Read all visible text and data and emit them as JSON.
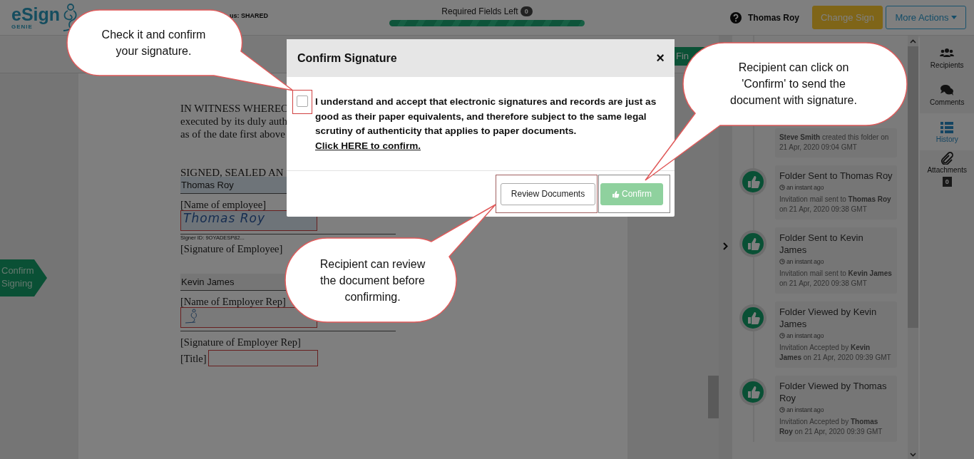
{
  "header": {
    "logo": {
      "name": "eSign",
      "tagline": "GENIE"
    },
    "status": "us: SHARED",
    "required_fields": {
      "label": "Required Fields Left",
      "count": "0",
      "level": 1
    },
    "user": "Thomas Roy",
    "buttons": [
      {
        "label": "Change Sign",
        "kind": "primary"
      },
      {
        "label": "More Actions",
        "kind": "dropdown"
      }
    ]
  },
  "toolbar": {
    "finish_button": "Fin"
  },
  "side_tag": "Confirm Signing",
  "document": {
    "paragraph_lines": [
      "IN WITNESS WHEREO",
      "executed by its duly auth",
      "as of the date first above"
    ],
    "heading": "SIGNED, SEALED AN",
    "blocks": [
      {
        "kind": "field",
        "text": "Thomas Roy"
      },
      {
        "kind": "caption",
        "text": "[Name of employee]"
      },
      {
        "kind": "signature",
        "text": "Thomas Roy"
      },
      {
        "kind": "signer_id",
        "text": "Signer ID: 9OYADESP82..."
      },
      {
        "kind": "caption",
        "text": "[Signature of Employee]"
      },
      {
        "kind": "field",
        "text": "Kevin James"
      },
      {
        "kind": "caption",
        "text": "[Name of Employer Rep]"
      },
      {
        "kind": "signature_drawing"
      },
      {
        "kind": "caption",
        "text": "[Signature of Employer Rep]"
      },
      {
        "kind": "labeled_box",
        "text": "[Title]"
      }
    ]
  },
  "history": [
    {
      "description": "**Steve Smith** created this folder on 21 Apr, 2020 09:04 GMT"
    },
    {
      "title": "Folder Sent to Thomas Roy",
      "time": "an instant ago",
      "description": "Invitation mail sent to **Thomas Roy** on 21 Apr, 2020 09:38 GMT"
    },
    {
      "title": "Folder Sent to Kevin James",
      "time": "an instant ago",
      "description": "Invitation mail sent to **Kevin James** on 21 Apr, 2020 09:38 GMT"
    },
    {
      "title": "Folder Viewed by Kevin James",
      "time": "an instant ago",
      "description": "Invitation Accepted by **Kevin James** on 21 Apr, 2020 09:39 GMT"
    },
    {
      "title": "Folder Viewed by Thomas Roy",
      "time": "an instant ago",
      "description": "Invitation Accepted by **Thomas Roy** on 21 Apr, 2020 09:39 GMT"
    }
  ],
  "sidebar": {
    "items": [
      {
        "label": "Recipients",
        "selected": false
      },
      {
        "label": "Comments",
        "selected": false
      },
      {
        "label": "History",
        "selected": true
      },
      {
        "label": "Attachments",
        "selected": false,
        "badge": "0"
      }
    ]
  },
  "modal": {
    "title": "Confirm Signature",
    "close": "×",
    "checkbox": {
      "checked": false
    },
    "statement": "I understand and accept that electronic signatures and records are just as good as their paper equivalents, and therefore subject to the same legal scrutiny of authenticity that applies to paper documents.",
    "link": "Click HERE to confirm.",
    "buttons": [
      {
        "label": "Review Documents",
        "kind": "secondary",
        "disabled": false
      },
      {
        "label": "Confirm",
        "kind": "confirm",
        "disabled": true
      }
    ]
  },
  "callouts": [
    {
      "text": "Check it and confirm your signature."
    },
    {
      "text": "Recipient can click on 'Confirm' to send the document with signature."
    },
    {
      "text": "Recipient can review the document before confirming."
    }
  ]
}
